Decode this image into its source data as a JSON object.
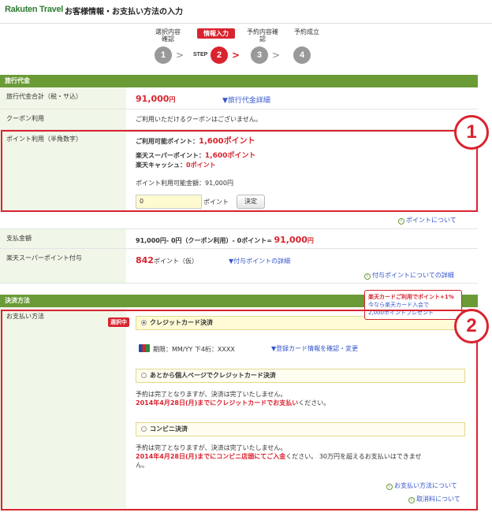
{
  "header": {
    "logo": "Rakuten Travel",
    "title": "お客様情報・お支払い方法の入力"
  },
  "steps": {
    "step_word": "STEP",
    "items": [
      {
        "label": "選択内容\n確認",
        "number": "1"
      },
      {
        "label": "情報入力",
        "number": "2"
      },
      {
        "label": "予約内容確\n認",
        "number": "3"
      },
      {
        "label": "予約成立",
        "number": "4"
      }
    ],
    "arrow": ">"
  },
  "travel_fee": {
    "section_title": "旅行代金",
    "total_label": "旅行代金合計（税・サ込）",
    "total_value": "91,000",
    "total_unit": "円",
    "detail_link": "▼旅行代金詳細",
    "coupon_label": "クーポン利用",
    "coupon_value": "ご利用いただけるクーポンはございません。",
    "points_label": "ポイント利用（半角数字）",
    "available_points_label": "ご利用可能ポイント：",
    "available_points_value": "1,600ポイント",
    "super_points_label": "楽天スーパーポイント：",
    "super_points_value": "1,600ポイント",
    "cash_label": "楽天キャッシュ：",
    "cash_value": "0ポイント",
    "usable_amount": "ポイント利用可能金額：91,000円",
    "points_input_value": "0",
    "points_unit": "ポイント",
    "apply_button": "決定",
    "about_points_link": "ポイントについて",
    "pay_amount_label": "支払金額",
    "pay_amount_formula": "91,000円- 0円（クーポン利用）- 0ポイント=",
    "pay_amount_value": "91,000",
    "pay_amount_unit": "円",
    "grant_label": "楽天スーパーポイント付与",
    "grant_value": "842",
    "grant_unit": "ポイント（仮）",
    "grant_detail_link": "▼付与ポイントの詳細",
    "grant_about_link": "付与ポイントについての詳細"
  },
  "payment": {
    "section_title": "決済方法",
    "method_label": "お支払い方法",
    "selected_tag": "選択中",
    "promo_line1": "楽天カードご利用でポイント+1%",
    "promo_line2": "今なら楽天カード入会で",
    "promo_line3": "2,000ポイントプレゼント",
    "option_credit": "クレジットカード決済",
    "card_info": "期限：MM/YY 下4桁：XXXX",
    "card_link": "▼登録カード情報を確認・変更",
    "option_later": "あとから個人ページでクレジットカード決済",
    "later_note1": "予約は完了となりますが、決済は完了いたしません。",
    "later_note2_red": "2014年4月28日(月)までにクレジットカードでお支払い",
    "later_note2_rest": "ください。",
    "option_conbini": "コンビニ決済",
    "conbini_note1": "予約は完了となりますが、決済は完了いたしません。",
    "conbini_note2_red": "2014年4月28日(月)までにコンビニ店頭にてご入金",
    "conbini_note2_rest": "ください。 30万円を超えるお支払いはできませ",
    "conbini_note3": "ん。",
    "about_payment_link": "お支払い方法について",
    "cancel_fee_link": "取消料について"
  },
  "annotations": {
    "badge1": "1",
    "badge2": "2"
  },
  "colors": {
    "accent_red": "#d9232e",
    "section_green": "#6a9b37",
    "label_bg": "#f1f7e8",
    "link_blue": "#3355cc"
  }
}
